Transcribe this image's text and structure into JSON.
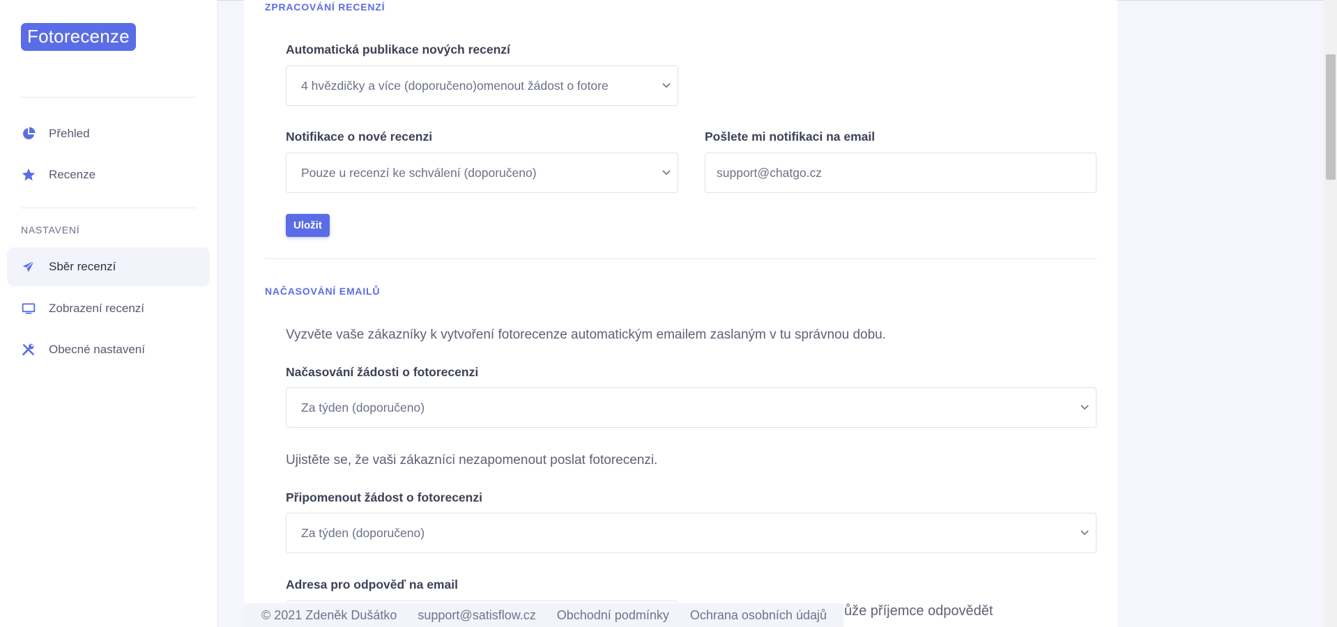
{
  "app": {
    "brand": "Fotorecenze"
  },
  "sidebar": {
    "items": [
      {
        "label": "Přehled",
        "icon": "pie-chart-icon"
      },
      {
        "label": "Recenze",
        "icon": "star-icon"
      }
    ],
    "section_label": "NASTAVENÍ",
    "settings_items": [
      {
        "label": "Sběr recenzí",
        "icon": "paper-plane-icon",
        "active": true
      },
      {
        "label": "Zobrazení recenzí",
        "icon": "monitor-icon"
      },
      {
        "label": "Obecné nastavení",
        "icon": "tools-icon"
      }
    ]
  },
  "processing": {
    "title": "ZPRACOVÁNÍ RECENZÍ",
    "auto_publish_label": "Automatická publikace nových recenzí",
    "auto_publish_value": "4 hvězdičky a více (doporučeno)omenout žádost o fotore",
    "notify_label": "Notifikace o nové recenzi",
    "notify_value": "Pouze u recenzí ke schválení (doporučeno)",
    "email_label": "Pošlete mi notifikaci na email",
    "email_value": "support@chatgo.cz",
    "save_label": "Uložit"
  },
  "timing": {
    "title": "NAČASOVÁNÍ EMAILŮ",
    "intro": "Vyzvěte vaše zákazníky k vytvoření fotorecenze automatickým emailem zaslaným v tu správnou dobu.",
    "request_label": "Načasování žádosti o fotorecenzi",
    "request_value": "Za týden (doporučeno)",
    "reminder_help": "Ujistěte se, že vaši zákazníci nezapomenout poslat fotorecenzi.",
    "reminder_label": "Připomenout žádost o fotorecenzi",
    "reminder_value": "Za týden (doporučeno)",
    "reply_label": "Adresa pro odpověď na email",
    "reply_help_partial": "ůže příjemce odpovědět"
  },
  "footer": {
    "copyright": "© 2021 Zdeněk Dušátko",
    "email": "support@satisflow.cz",
    "terms": "Obchodní podmínky",
    "privacy": "Ochrana osobních údajů"
  },
  "colors": {
    "accent": "#5a6de6",
    "background": "#f5f6fd"
  }
}
